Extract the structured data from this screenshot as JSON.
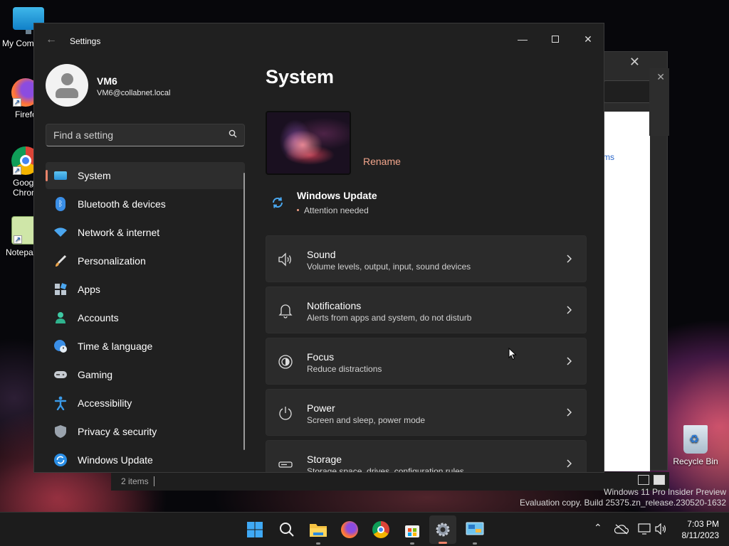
{
  "desktop": {
    "icons": [
      {
        "label": "My Com"
      },
      {
        "label": "Firefo"
      },
      {
        "label": "Goog\nChron"
      },
      {
        "label": "Notepa"
      }
    ],
    "recycle_bin": "Recycle Bin",
    "watermark_line1": "Windows 11 Pro Insider Preview",
    "watermark_line2": "Evaluation copy. Build 25375.zn_release.230520-1632"
  },
  "background_window": {
    "link_text": "ms",
    "status_items": "2 items"
  },
  "settings": {
    "window_title": "Settings",
    "profile": {
      "name": "VM6",
      "email": "VM6@collabnet.local"
    },
    "search": {
      "placeholder": "Find a setting"
    },
    "nav": [
      {
        "label": "System",
        "icon": "monitor-icon",
        "active": true
      },
      {
        "label": "Bluetooth & devices",
        "icon": "bluetooth-icon"
      },
      {
        "label": "Network & internet",
        "icon": "wifi-icon"
      },
      {
        "label": "Personalization",
        "icon": "brush-icon"
      },
      {
        "label": "Apps",
        "icon": "apps-icon"
      },
      {
        "label": "Accounts",
        "icon": "person-icon"
      },
      {
        "label": "Time & language",
        "icon": "globe-clock-icon"
      },
      {
        "label": "Gaming",
        "icon": "gamepad-icon"
      },
      {
        "label": "Accessibility",
        "icon": "accessibility-icon"
      },
      {
        "label": "Privacy & security",
        "icon": "shield-icon"
      },
      {
        "label": "Windows Update",
        "icon": "update-icon"
      }
    ],
    "page_title": "System",
    "rename_label": "Rename",
    "windows_update": {
      "title": "Windows Update",
      "status": "Attention needed"
    },
    "cards": [
      {
        "title": "Sound",
        "subtitle": "Volume levels, output, input, sound devices",
        "icon": "speaker-icon"
      },
      {
        "title": "Notifications",
        "subtitle": "Alerts from apps and system, do not disturb",
        "icon": "bell-icon"
      },
      {
        "title": "Focus",
        "subtitle": "Reduce distractions",
        "icon": "focus-icon"
      },
      {
        "title": "Power",
        "subtitle": "Screen and sleep, power mode",
        "icon": "power-icon"
      },
      {
        "title": "Storage",
        "subtitle": "Storage space, drives, configuration rules",
        "icon": "storage-icon"
      }
    ],
    "accent_color": "#f0826a"
  },
  "taskbar": {
    "apps": [
      "start-icon",
      "search-icon",
      "file-explorer-icon",
      "firefox-icon",
      "chrome-icon",
      "store-icon",
      "settings-icon",
      "control-panel-icon"
    ],
    "time": "7:03 PM",
    "date": "8/11/2023"
  }
}
